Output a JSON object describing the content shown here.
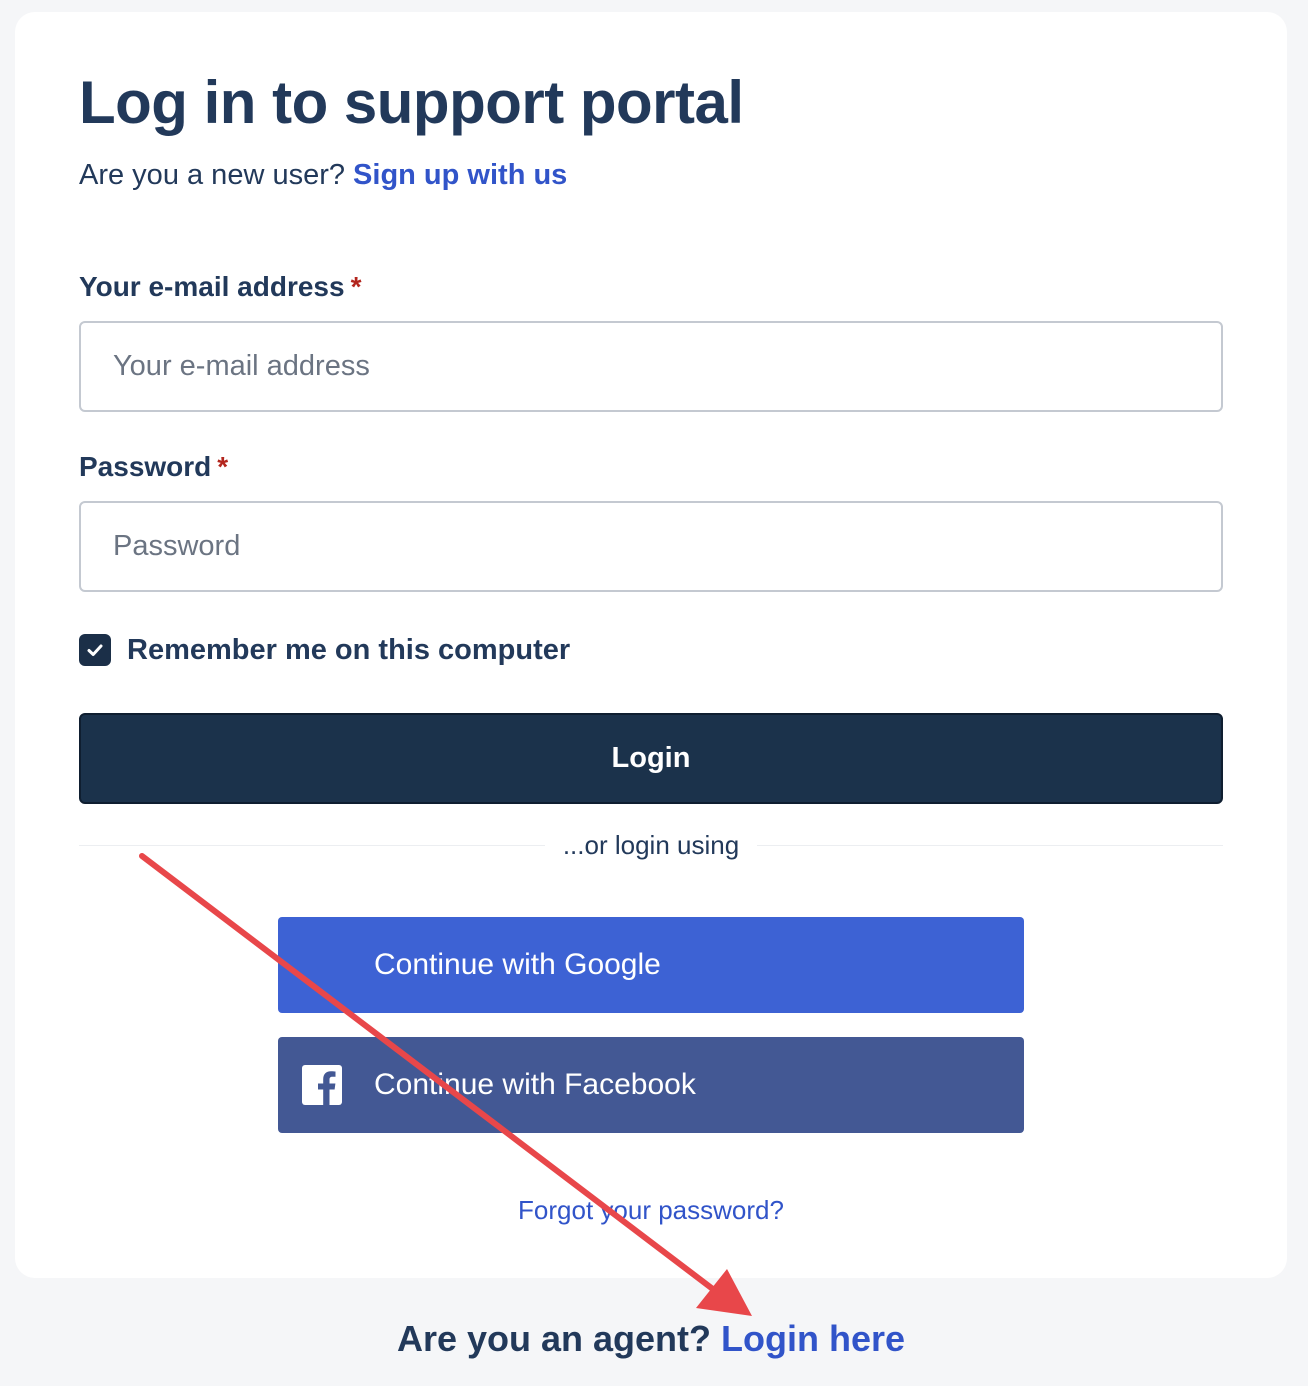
{
  "page": {
    "title": "Log in to support portal",
    "subtitle_prefix": "Are you a new user?",
    "signup_link": "Sign up with us"
  },
  "form": {
    "email": {
      "label": "Your e-mail address",
      "required_mark": "*",
      "placeholder": "Your e-mail address",
      "value": ""
    },
    "password": {
      "label": "Password",
      "required_mark": "*",
      "placeholder": "Password",
      "value": ""
    },
    "remember": {
      "label": "Remember me on this computer",
      "checked": true
    },
    "login_button": "Login"
  },
  "social": {
    "divider_text": "...or login using",
    "google_label": "Continue with Google",
    "facebook_label": "Continue with Facebook",
    "facebook_icon": "facebook-icon"
  },
  "forgot_password": "Forgot your password?",
  "agent": {
    "prefix": "Are you an agent?",
    "link": "Login here"
  },
  "annotation": {
    "color": "#e8474a"
  },
  "colors": {
    "link": "#3154c9",
    "primary_button": "#1b324b",
    "google": "#3d62d4",
    "facebook": "#435894"
  }
}
